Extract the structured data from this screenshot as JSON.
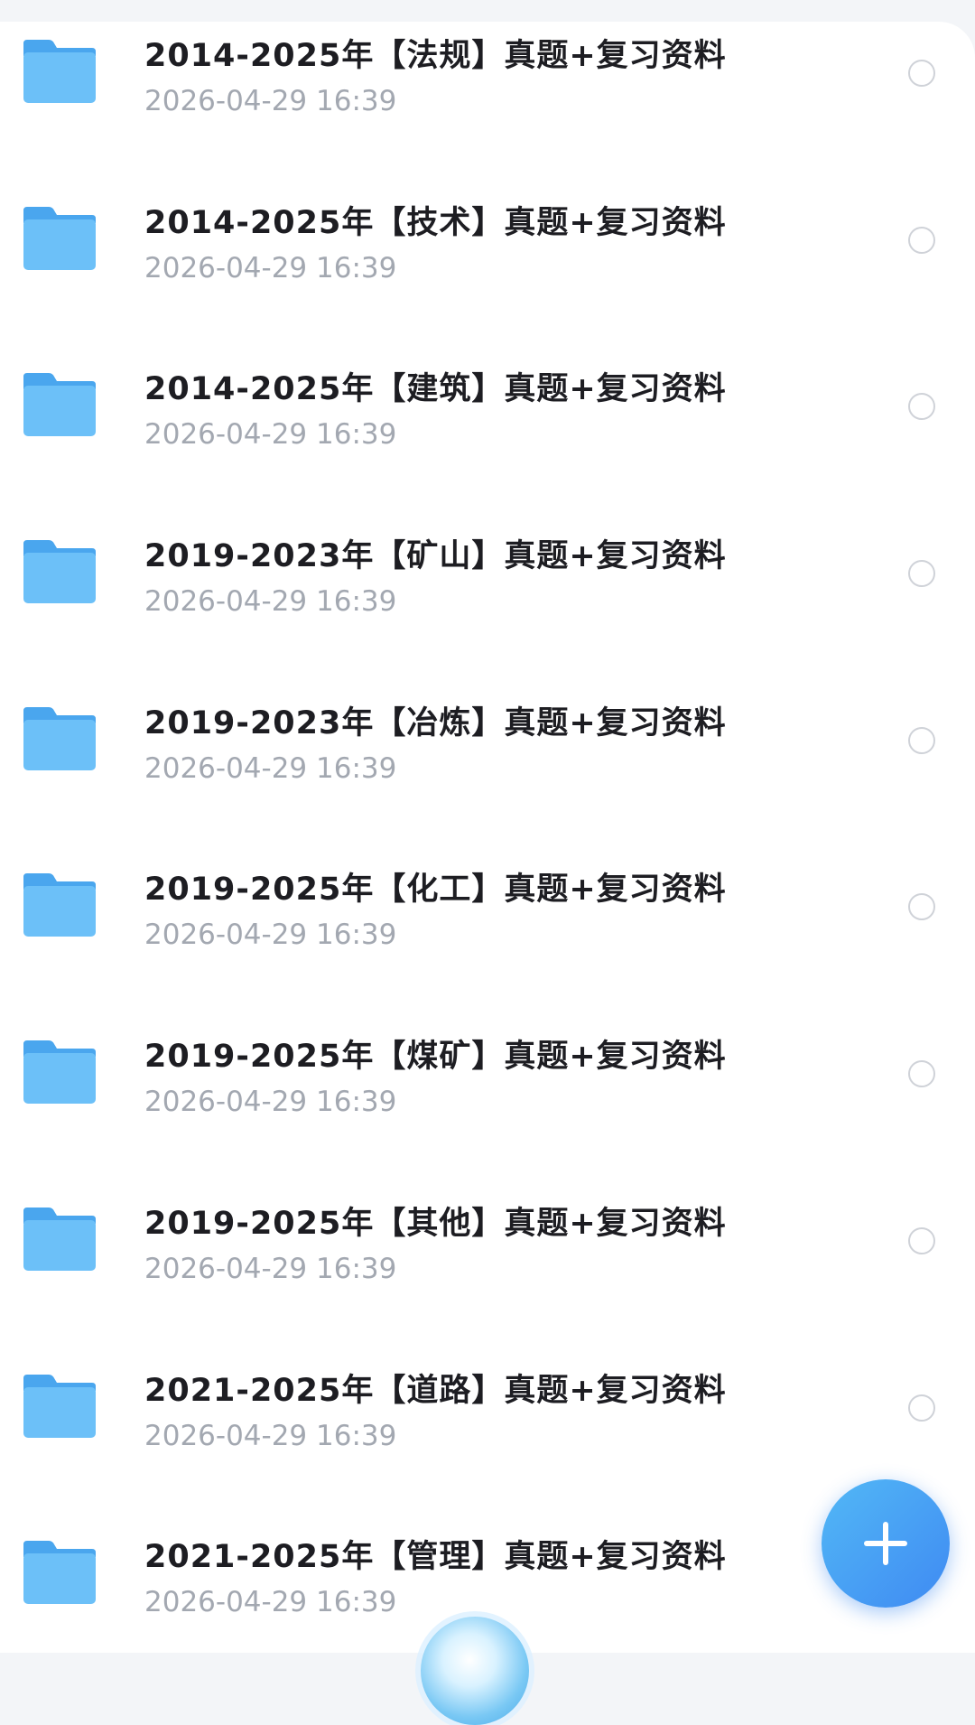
{
  "files": [
    {
      "name": "2014-2025年【法规】真题+复习资料",
      "date": "2026-04-29 16:39",
      "icon": "folder-icon"
    },
    {
      "name": "2014-2025年【技术】真题+复习资料",
      "date": "2026-04-29 16:39",
      "icon": "folder-icon"
    },
    {
      "name": "2014-2025年【建筑】真题+复习资料",
      "date": "2026-04-29 16:39",
      "icon": "folder-icon"
    },
    {
      "name": "2019-2023年【矿山】真题+复习资料",
      "date": "2026-04-29 16:39",
      "icon": "folder-icon"
    },
    {
      "name": "2019-2023年【冶炼】真题+复习资料",
      "date": "2026-04-29 16:39",
      "icon": "folder-icon"
    },
    {
      "name": "2019-2025年【化工】真题+复习资料",
      "date": "2026-04-29 16:39",
      "icon": "folder-icon"
    },
    {
      "name": "2019-2025年【煤矿】真题+复习资料",
      "date": "2026-04-29 16:39",
      "icon": "folder-icon"
    },
    {
      "name": "2019-2025年【其他】真题+复习资料",
      "date": "2026-04-29 16:39",
      "icon": "folder-icon"
    },
    {
      "name": "2021-2025年【道路】真题+复习资料",
      "date": "2026-04-29 16:39",
      "icon": "folder-icon"
    },
    {
      "name": "2021-2025年【管理】真题+复习资料",
      "date": "2026-04-29 16:39",
      "icon": "folder-icon"
    }
  ],
  "fab": {
    "icon": "plus-icon"
  },
  "colors": {
    "accent": "#4a9ff4",
    "folder": "#6cc0f8",
    "title_text": "#1d1d22",
    "date_text": "#a3a8b1",
    "background": "#ffffff"
  }
}
